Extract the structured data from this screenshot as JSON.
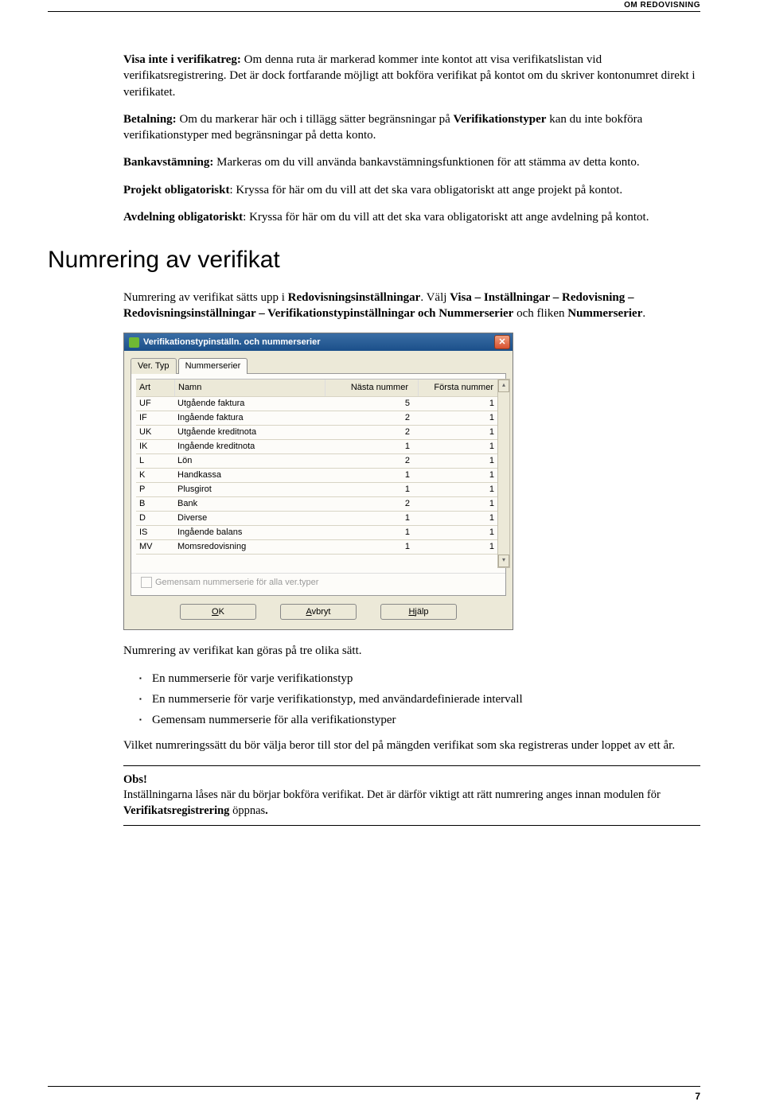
{
  "header": "OM REDOVISNING",
  "p1_lead": "Visa inte i verifikatreg:",
  "p1_rest": " Om denna ruta är markerad kommer inte kontot att visa verifikatslistan vid verifikatsregistrering. Det är dock fortfarande möjligt att bokföra verifikat på kontot om du skriver kontonumret direkt i verifikatet.",
  "p2_lead": "Betalning:",
  "p2_rest": " Om du markerar här och i tillägg sätter begränsningar på ",
  "p2_b": "Verifikationstyper",
  "p2_rest2": " kan du inte bokföra verifikationstyper med begränsningar på detta konto.",
  "p3_lead": "Bankavstämning:",
  "p3_rest": " Markeras om du vill använda bankavstämningsfunktionen för att stämma av detta konto.",
  "p4_lead": "Projekt obligatoriskt",
  "p4_rest": ": Kryssa för här om du vill att det ska vara obligatoriskt att ange projekt på kontot.",
  "p5_lead": "Avdelning obligatoriskt",
  "p5_rest": ": Kryssa för här om du vill att det ska vara obligatoriskt att ange avdelning på kontot.",
  "section_title": "Numrering av verifikat",
  "sec_p1_a": "Numrering av verifikat sätts upp i ",
  "sec_p1_b": "Redovisningsinställningar",
  "sec_p1_c": ". Välj ",
  "sec_p1_d": "Visa – Inställningar – Redovisning – Redovisningsinställningar – Verifikationstypinställningar och Nummerserier",
  "sec_p1_e": " och fliken ",
  "sec_p1_f": "Nummerserier",
  "sec_p1_g": ".",
  "dialog": {
    "title": "Verifikationstypinställn. och nummerserier",
    "tabs": {
      "t1": "Ver. Typ",
      "t2": "Nummerserier"
    },
    "columns": {
      "art": "Art",
      "namn": "Namn",
      "nn": "Nästa nummer",
      "fn": "Första nummer"
    },
    "rows": [
      {
        "art": "UF",
        "namn": "Utgående faktura",
        "nn": "5",
        "fn": "1"
      },
      {
        "art": "IF",
        "namn": "Ingående faktura",
        "nn": "2",
        "fn": "1"
      },
      {
        "art": "UK",
        "namn": "Utgående kreditnota",
        "nn": "2",
        "fn": "1"
      },
      {
        "art": "IK",
        "namn": "Ingående kreditnota",
        "nn": "1",
        "fn": "1"
      },
      {
        "art": "L",
        "namn": "Lön",
        "nn": "2",
        "fn": "1"
      },
      {
        "art": "K",
        "namn": "Handkassa",
        "nn": "1",
        "fn": "1"
      },
      {
        "art": "P",
        "namn": "Plusgirot",
        "nn": "1",
        "fn": "1"
      },
      {
        "art": "B",
        "namn": "Bank",
        "nn": "2",
        "fn": "1"
      },
      {
        "art": "D",
        "namn": "Diverse",
        "nn": "1",
        "fn": "1"
      },
      {
        "art": "IS",
        "namn": "Ingående balans",
        "nn": "1",
        "fn": "1"
      },
      {
        "art": "MV",
        "namn": "Momsredovisning",
        "nn": "1",
        "fn": "1"
      }
    ],
    "chk_label": "Gemensam nummerserie för alla ver.typer",
    "buttons": {
      "ok": "OK",
      "avbryt": "Avbryt",
      "hjalp": "Hjälp"
    }
  },
  "sec_p2": "Numrering av verifikat kan göras på tre olika sätt.",
  "bullets": [
    "En nummerserie för varje verifikationstyp",
    "En nummerserie för varje verifikationstyp, med användardefinierade intervall",
    "Gemensam nummerserie för alla verifikationstyper"
  ],
  "sec_p3": "Vilket numreringssätt du bör välja beror till stor del på mängden verifikat som ska registreras under loppet av ett år.",
  "obs": {
    "title": "Obs!",
    "line_a": "Inställningarna låses när du börjar bokföra verifikat. Det är därför viktigt att rätt numrering anges innan modulen för ",
    "line_b": "Verifikatsregistrering",
    "line_c": " öppnas",
    "line_d": "."
  },
  "page_number": "7"
}
